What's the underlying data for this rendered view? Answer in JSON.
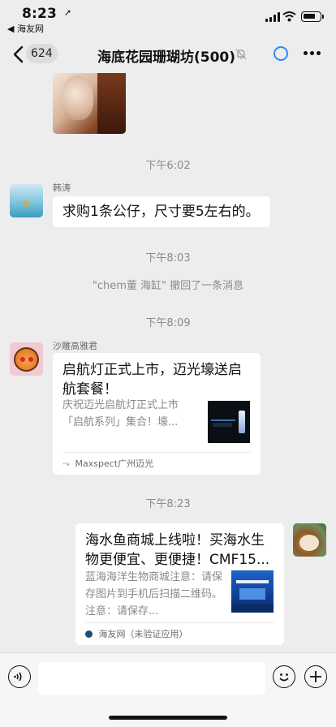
{
  "status_bar": {
    "time": "8:23",
    "back_app": "◀ 海友网"
  },
  "nav": {
    "unread_count": "624",
    "title": "海底花园珊瑚坊(500)"
  },
  "messages": {
    "ts1": "下午6:02",
    "m1_sender": "韩涛",
    "m1_text": "求购1条公仔，尺寸要5左右的。",
    "ts2": "下午8:03",
    "recall_notice": "\"chem董 海缸\" 撤回了一条消息",
    "ts3": "下午8:09",
    "m2_sender": "沙雕高雅君",
    "m2_title": "启航灯正式上市，迈光壕送启航套餐！",
    "m2_desc": "庆祝迈光启航灯正式上市「启航系列」集合！壕...",
    "m2_source": "Maxspect广州迈光",
    "ts4": "下午8:23",
    "m3_title": "海水鱼商城上线啦！买海水生物更便宜、更便捷！CMF15...",
    "m3_desc": "蓝海海洋生物商城注意：请保存图片到手机后扫描二维码。注意：请保存...",
    "m3_source": "海友网（未验证应用）"
  },
  "colors": {
    "background": "#ededed",
    "bubble": "#ffffff",
    "accent": "#2f89fc"
  }
}
